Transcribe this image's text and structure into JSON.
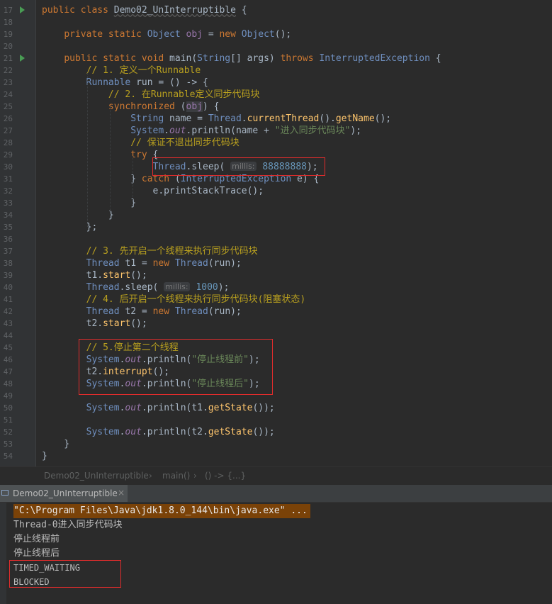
{
  "editor": {
    "file": "Demo02_UnInterruptible",
    "lines": [
      {
        "n": "17",
        "html": "<span class=\"kw\">public class </span><span class=\"cls\" style=\"text-decoration:underline wavy #5a5a5a\">Demo02_UnInterruptible</span> {",
        "run": true
      },
      {
        "n": "18",
        "html": ""
      },
      {
        "n": "19",
        "html": "    <span class=\"kw\">private static </span><span class=\"type\">Object</span> <span class=\"fld\" style=\"font-style:normal;color:#9876aa\">obj</span> = <span class=\"kw\">new </span><span class=\"type\">Object</span>();"
      },
      {
        "n": "20",
        "html": ""
      },
      {
        "n": "21",
        "html": "    <span class=\"kw\">public static void </span><span class=\"fn\" style=\"color:#a9b7c6\">main</span>(<span class=\"type\">String</span>[] args) <span class=\"kw\">throws </span><span class=\"type\">InterruptedException</span> {",
        "run": true
      },
      {
        "n": "22",
        "html": "        <span class=\"cm\">// 1. 定义一个Runnable</span>"
      },
      {
        "n": "23",
        "html": "        <span class=\"type\">Runnable</span> run = () -> {"
      },
      {
        "n": "24",
        "html": "            <span class=\"cm\">// 2. 在Runnable定义同步代码块</span>"
      },
      {
        "n": "25",
        "html": "            <span class=\"kw\">synchronized </span>(<span class=\"obj-hl\" style=\"color:#9876aa\">obj</span>) {"
      },
      {
        "n": "26",
        "html": "                <span class=\"type\">String</span> name = <span class=\"type\">Thread</span>.<span class=\"fn\">currentThread</span>().<span class=\"fn\">getName</span>();"
      },
      {
        "n": "27",
        "html": "                <span class=\"type\">System</span>.<span class=\"fld\">out</span>.println(name + <span class=\"str\">\"进入同步代码块\"</span>);"
      },
      {
        "n": "28",
        "html": "                <span class=\"cm\">// 保证不退出同步代码块</span>"
      },
      {
        "n": "29",
        "html": "                <span class=\"kw\">try </span>{"
      },
      {
        "n": "30",
        "html": "                    <span class=\"type\">Thread</span>.sleep( <span class=\"hint\">millis:</span> <span class=\"num\">88888888</span>);"
      },
      {
        "n": "31",
        "html": "                } <span class=\"kw\">catch </span>(<span class=\"type\">InterruptedException</span> e) {"
      },
      {
        "n": "32",
        "html": "                    e.printStackTrace();"
      },
      {
        "n": "33",
        "html": "                }"
      },
      {
        "n": "34",
        "html": "            }"
      },
      {
        "n": "35",
        "html": "        };"
      },
      {
        "n": "36",
        "html": ""
      },
      {
        "n": "37",
        "html": "        <span class=\"cm\">// 3. 先开启一个线程来执行同步代码块</span>"
      },
      {
        "n": "38",
        "html": "        <span class=\"type\">Thread</span> t1 = <span class=\"kw\">new </span><span class=\"type\">Thread</span>(run);"
      },
      {
        "n": "39",
        "html": "        t1.<span class=\"fn\">start</span>();"
      },
      {
        "n": "40",
        "html": "        <span class=\"type\">Thread</span>.sleep( <span class=\"hint\">millis:</span> <span class=\"num\">1000</span>);"
      },
      {
        "n": "41",
        "html": "        <span class=\"cm\">// 4. 后开启一个线程来执行同步代码块(阻塞状态)</span>"
      },
      {
        "n": "42",
        "html": "        <span class=\"type\">Thread</span> t2 = <span class=\"kw\">new </span><span class=\"type\">Thread</span>(run);"
      },
      {
        "n": "43",
        "html": "        t2.<span class=\"fn\">start</span>();"
      },
      {
        "n": "44",
        "html": ""
      },
      {
        "n": "45",
        "html": "        <span class=\"cm\">// 5.停止第二个线程</span>"
      },
      {
        "n": "46",
        "html": "        <span class=\"type\">System</span>.<span class=\"fld\">out</span>.println(<span class=\"str\">\"停止线程前\"</span>);"
      },
      {
        "n": "47",
        "html": "        t2.<span class=\"fn\">interrupt</span>();"
      },
      {
        "n": "48",
        "html": "        <span class=\"type\">System</span>.<span class=\"fld\">out</span>.println(<span class=\"str\">\"停止线程后\"</span>);"
      },
      {
        "n": "49",
        "html": ""
      },
      {
        "n": "50",
        "html": "        <span class=\"type\">System</span>.<span class=\"fld\">out</span>.println(t1.<span class=\"fn\">getState</span>());"
      },
      {
        "n": "51",
        "html": ""
      },
      {
        "n": "52",
        "html": "        <span class=\"type\">System</span>.<span class=\"fld\">out</span>.println(t2.<span class=\"fn\">getState</span>());"
      },
      {
        "n": "53",
        "html": "    }"
      },
      {
        "n": "54",
        "html": "}"
      }
    ]
  },
  "breadcrumb": {
    "class_name": "Demo02_UnInterruptible",
    "method": "main()",
    "lambda": "() -> {...}"
  },
  "run_panel": {
    "tab_label": "Demo02_UnInterruptible",
    "close_glyph": "×",
    "output": [
      "\"C:\\Program Files\\Java\\jdk1.8.0_144\\bin\\java.exe\" ...",
      "Thread-0进入同步代码块",
      "停止线程前",
      "停止线程后",
      "TIMED_WAITING",
      "BLOCKED"
    ]
  },
  "colors": {
    "editor_bg": "#2b2b2b",
    "highlight_box": "#e22c2c",
    "command_line_bg": "#7a4208"
  }
}
